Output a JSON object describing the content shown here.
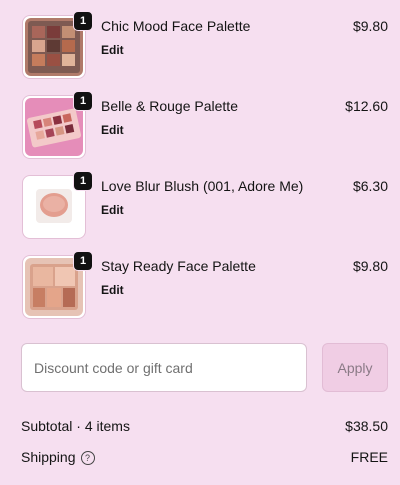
{
  "cart": {
    "items": [
      {
        "name": "Chic Mood Face Palette",
        "edit": "Edit",
        "price": "$9.80",
        "quantity": "1"
      },
      {
        "name": "Belle & Rouge Palette",
        "edit": "Edit",
        "price": "$12.60",
        "quantity": "1"
      },
      {
        "name": "Love Blur Blush (001, Adore Me)",
        "edit": "Edit",
        "price": "$6.30",
        "quantity": "1"
      },
      {
        "name": "Stay Ready Face Palette",
        "edit": "Edit",
        "price": "$9.80",
        "quantity": "1"
      }
    ]
  },
  "discount": {
    "placeholder": "Discount code or gift card",
    "apply_label": "Apply"
  },
  "summary": {
    "subtotal_label": "Subtotal · 4 items",
    "subtotal_value": "$38.50",
    "shipping_label": "Shipping",
    "shipping_value": "FREE",
    "help_icon": "?"
  },
  "colors": {
    "background": "#f6dff0",
    "apply_button": "#f0cde4"
  }
}
